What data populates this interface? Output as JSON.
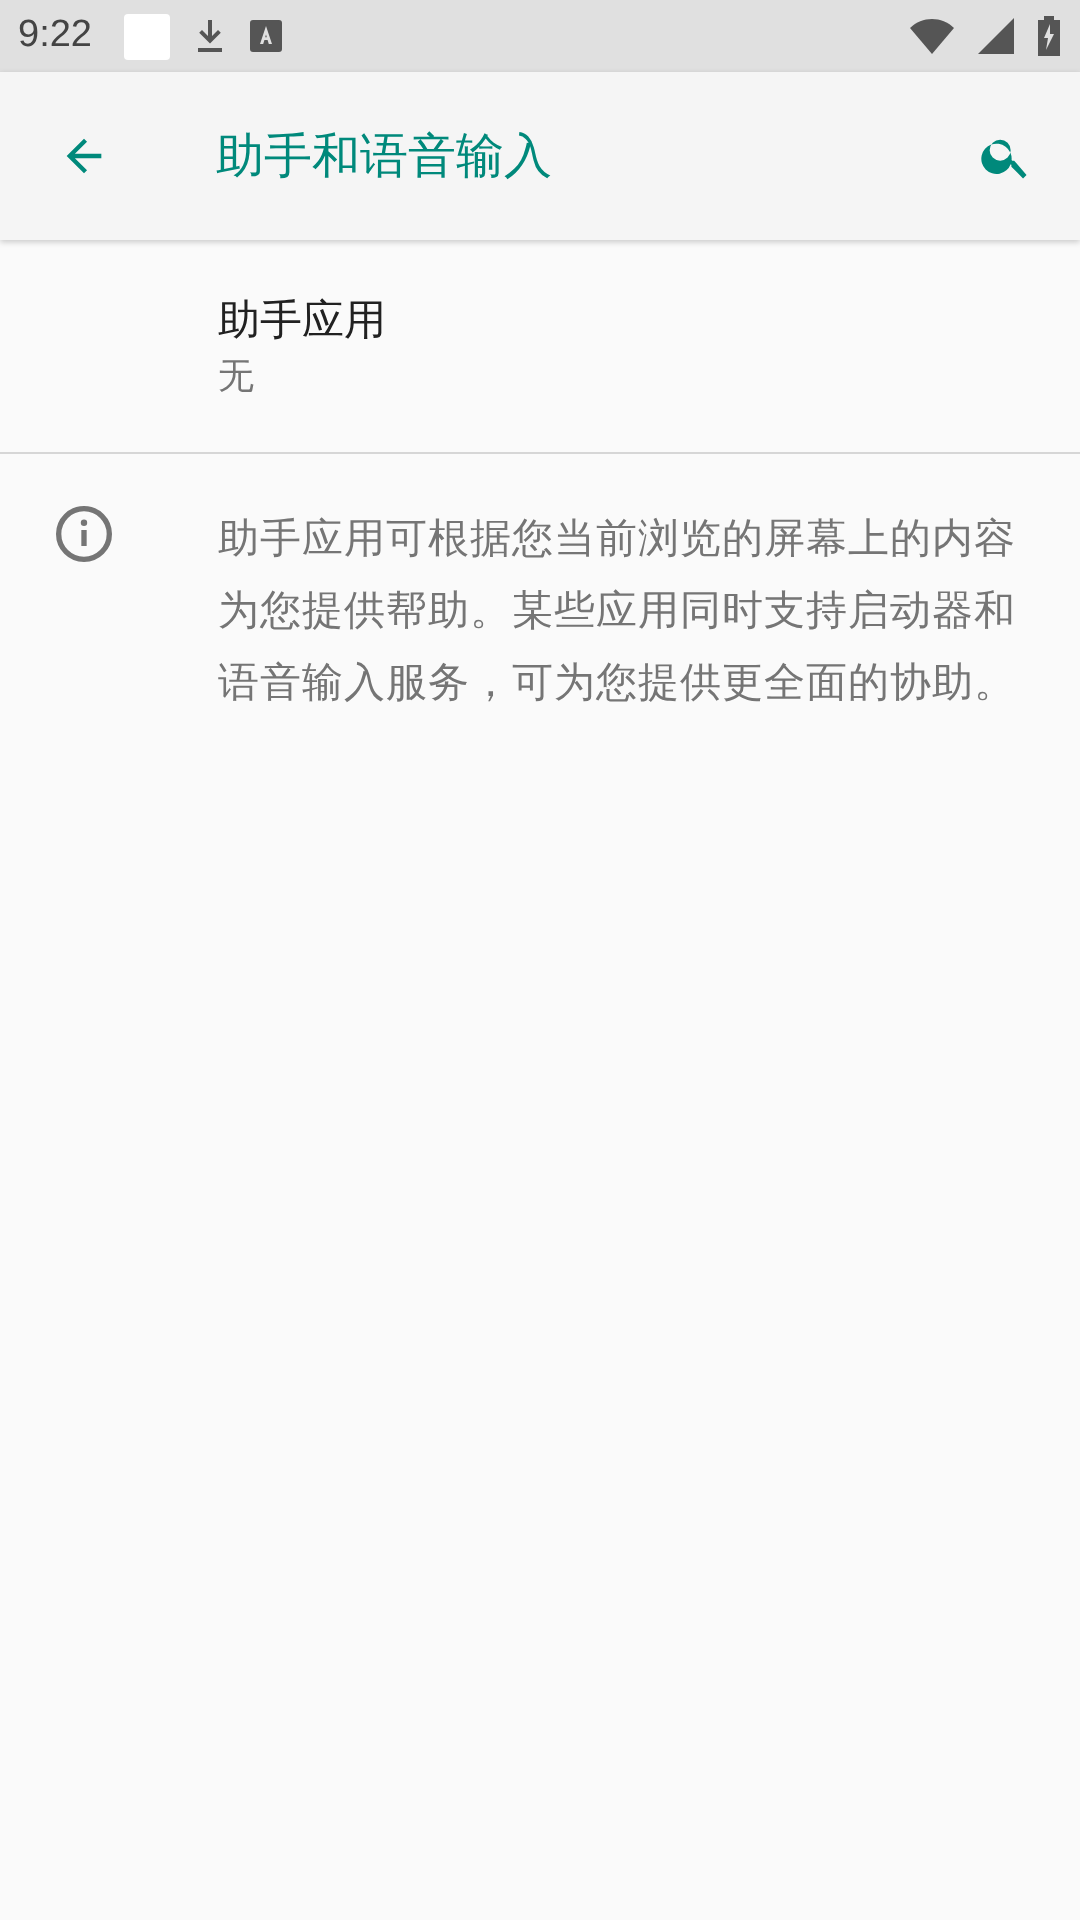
{
  "status_bar": {
    "time": "9:22"
  },
  "app_bar": {
    "title": "助手和语音输入"
  },
  "settings": [
    {
      "title": "助手应用",
      "summary": "无"
    }
  ],
  "footer": {
    "text": "助手应用可根据您当前浏览的屏幕上的内容为您提供帮助。某些应用同时支持启动器和语音输入服务，可为您提供更全面的协助。"
  }
}
